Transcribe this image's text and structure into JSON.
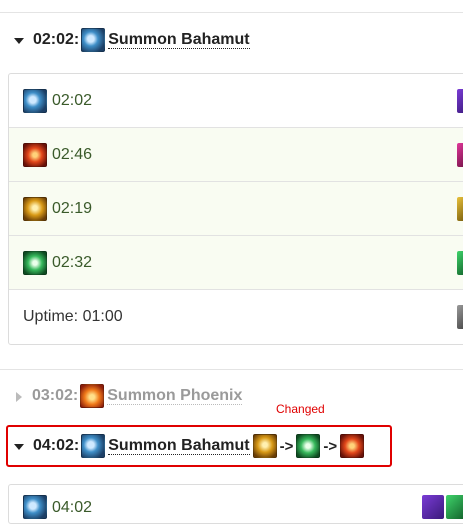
{
  "sections": [
    {
      "time": "02:02:",
      "name": "Summon Bahamut",
      "icon": "bahamut-icon",
      "expanded": true
    },
    {
      "time": "03:02:",
      "name": "Summon Phoenix",
      "icon": "phoenix-icon",
      "expanded": false
    },
    {
      "time": "04:02:",
      "name": "Summon Bahamut",
      "icon": "bahamut-icon",
      "expanded": true,
      "change_chain": [
        "titan-icon",
        "garuda-icon",
        "ifrit-icon"
      ],
      "arrow": "->"
    }
  ],
  "rows": [
    {
      "icon": "bahamut-icon",
      "value": "02:02"
    },
    {
      "icon": "ifrit-icon",
      "value": "02:46"
    },
    {
      "icon": "titan-icon",
      "value": "02:19"
    },
    {
      "icon": "garuda-icon",
      "value": "02:32"
    },
    {
      "value": "Uptime: 01:00"
    }
  ],
  "second_table": {
    "first_row_value": "04:02"
  },
  "changed_label": "Changed",
  "colors": {
    "highlight": "#e00000",
    "row_tint": "#f9fcf2",
    "value_text": "#3a5a2a"
  }
}
